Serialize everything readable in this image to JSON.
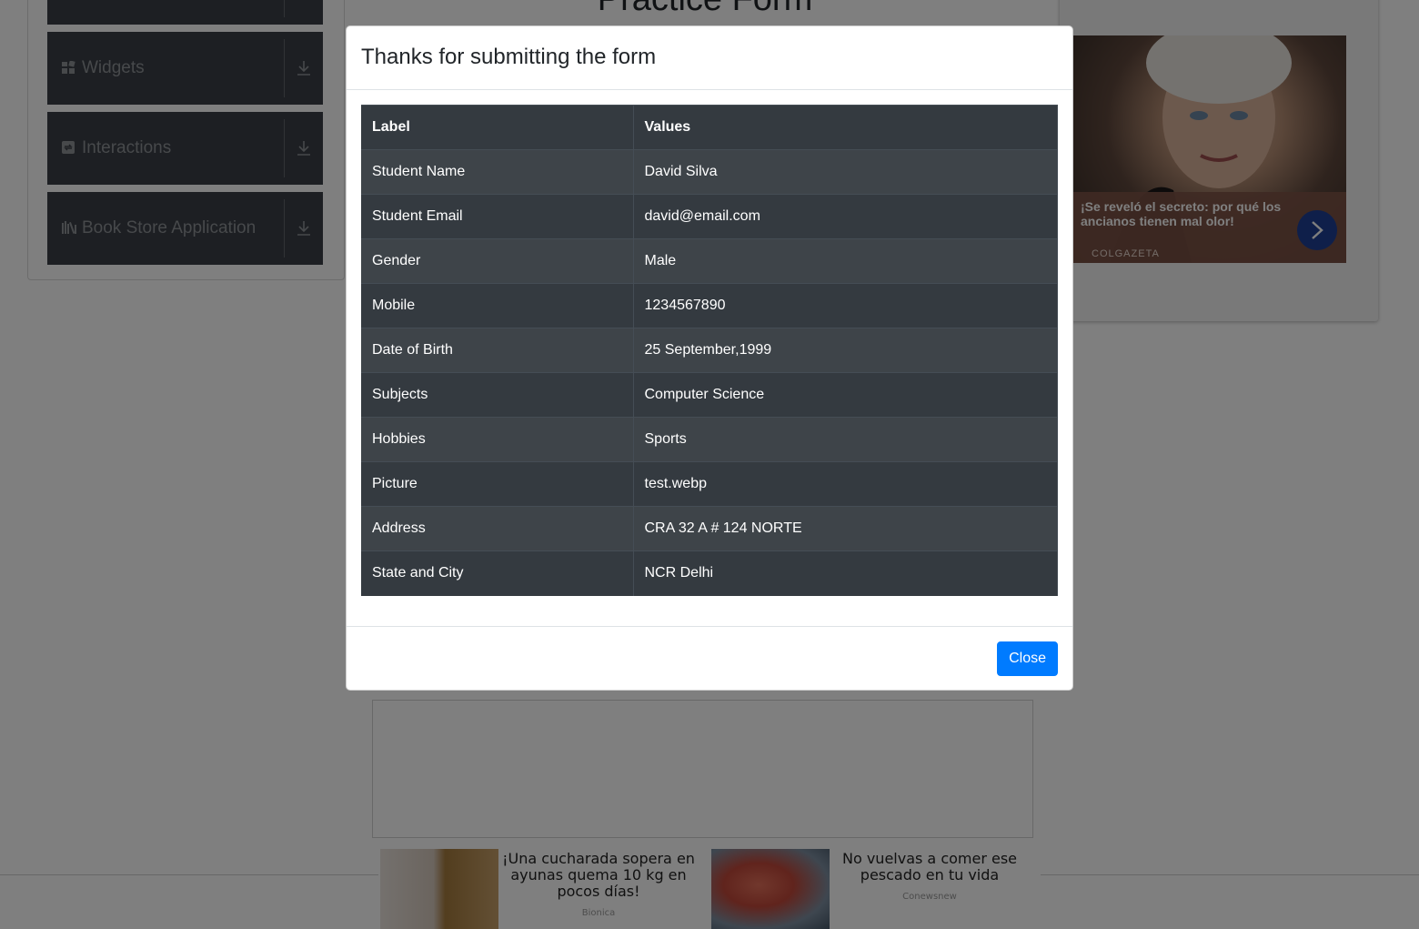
{
  "page": {
    "title": "Practice Form"
  },
  "sidebar": {
    "groups": [
      {
        "label": "Widgets",
        "icon": "widgets-icon"
      },
      {
        "label": "Interactions",
        "icon": "interactions-icon"
      },
      {
        "label": "Book Store Application",
        "icon": "book-store-icon"
      }
    ]
  },
  "side_ad": {
    "text": "¡Se reveló el secreto: por qué los ancianos tienen mal olor!",
    "brand": "COLGAZETA"
  },
  "bottom_ad": {
    "items": [
      {
        "headline": "¡Una cucharada sopera en ayunas quema 10 kg en pocos días!",
        "source": "Bionica"
      },
      {
        "headline": "No vuelvas a comer ese pescado en tu vida",
        "source": "Conewsnew"
      }
    ]
  },
  "modal": {
    "title": "Thanks for submitting the form",
    "table": {
      "headers": [
        "Label",
        "Values"
      ],
      "rows": [
        [
          "Student Name",
          "David Silva"
        ],
        [
          "Student Email",
          "david@email.com"
        ],
        [
          "Gender",
          "Male"
        ],
        [
          "Mobile",
          "1234567890"
        ],
        [
          "Date of Birth",
          "25 September,1999"
        ],
        [
          "Subjects",
          "Computer Science"
        ],
        [
          "Hobbies",
          "Sports"
        ],
        [
          "Picture",
          "test.webp"
        ],
        [
          "Address",
          "CRA 32 A # 124 NORTE"
        ],
        [
          "State and City",
          "NCR Delhi"
        ]
      ]
    },
    "close_label": "Close"
  },
  "colors": {
    "table_bg": "#343a40",
    "primary": "#007bff",
    "sidebar_group_bg": "#3a3f47"
  }
}
